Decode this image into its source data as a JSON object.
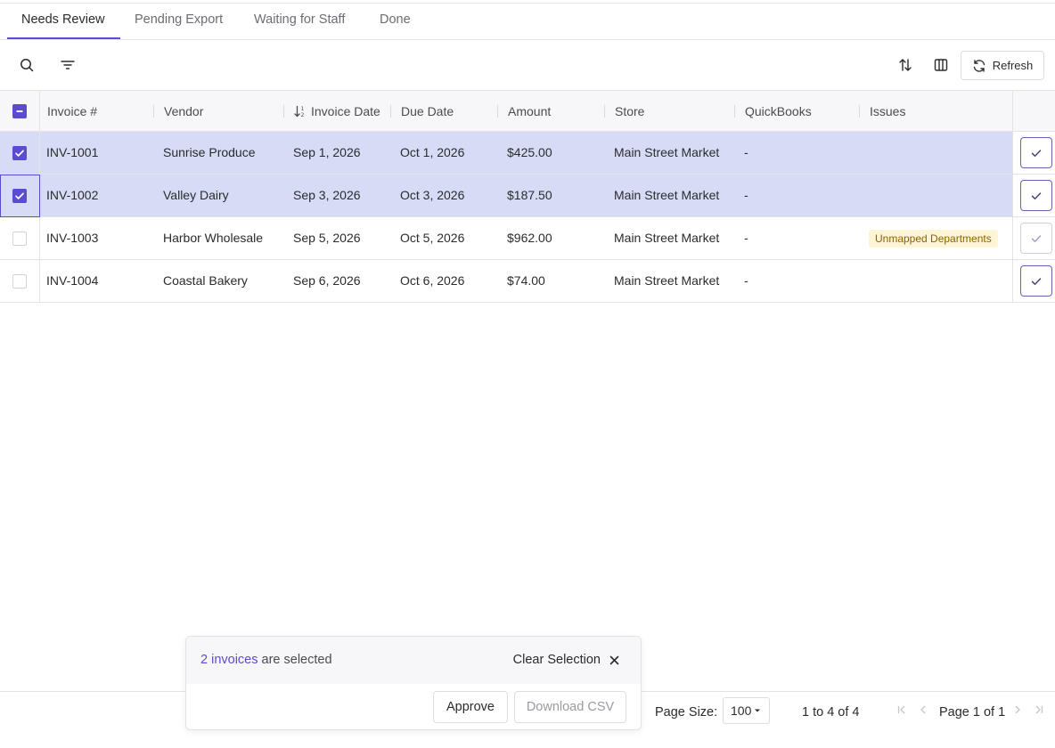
{
  "tabs": [
    {
      "label": "Needs Review",
      "active": true
    },
    {
      "label": "Pending Export",
      "active": false
    },
    {
      "label": "Waiting for Staff",
      "active": false
    },
    {
      "label": "Done",
      "active": false
    }
  ],
  "toolbar": {
    "refresh_label": "Refresh"
  },
  "grid": {
    "columns": [
      "Invoice #",
      "Vendor",
      "Invoice Date",
      "Due Date",
      "Amount",
      "Store",
      "QuickBooks",
      "Issues"
    ],
    "rows": [
      {
        "selected": true,
        "invoice": "INV-1001",
        "vendor": "Sunrise Produce",
        "invoice_date": "Sep 1, 2026",
        "due_date": "Oct 1, 2026",
        "amount": "$425.00",
        "store": "Main Street Market",
        "quickbooks": "-",
        "issues": ""
      },
      {
        "selected": true,
        "invoice": "INV-1002",
        "vendor": "Valley Dairy",
        "invoice_date": "Sep 3, 2026",
        "due_date": "Oct 3, 2026",
        "amount": "$187.50",
        "store": "Main Street Market",
        "quickbooks": "-",
        "issues": ""
      },
      {
        "selected": false,
        "invoice": "INV-1003",
        "vendor": "Harbor Wholesale",
        "invoice_date": "Sep 5, 2026",
        "due_date": "Oct 5, 2026",
        "amount": "$962.00",
        "store": "Main Street Market",
        "quickbooks": "-",
        "issues": "Unmapped Departments"
      },
      {
        "selected": false,
        "invoice": "INV-1004",
        "vendor": "Coastal Bakery",
        "invoice_date": "Sep 6, 2026",
        "due_date": "Oct 6, 2026",
        "amount": "$74.00",
        "store": "Main Street Market",
        "quickbooks": "-",
        "issues": ""
      }
    ]
  },
  "selection": {
    "count_text": "2 invoices",
    "suffix": "are selected",
    "clear_label": "Clear Selection",
    "approve_label": "Approve",
    "download_label": "Download CSV"
  },
  "pagination": {
    "page_size_label": "Page Size:",
    "page_size": "100",
    "range": "1 to 4 of 4",
    "page_text": "Page 1 of 1"
  },
  "colors": {
    "accent": "#5b4bd1",
    "selected_row": "#d6dcf5",
    "issue_badge_bg": "#fdf5d5",
    "issue_badge_text": "#8a6200"
  }
}
